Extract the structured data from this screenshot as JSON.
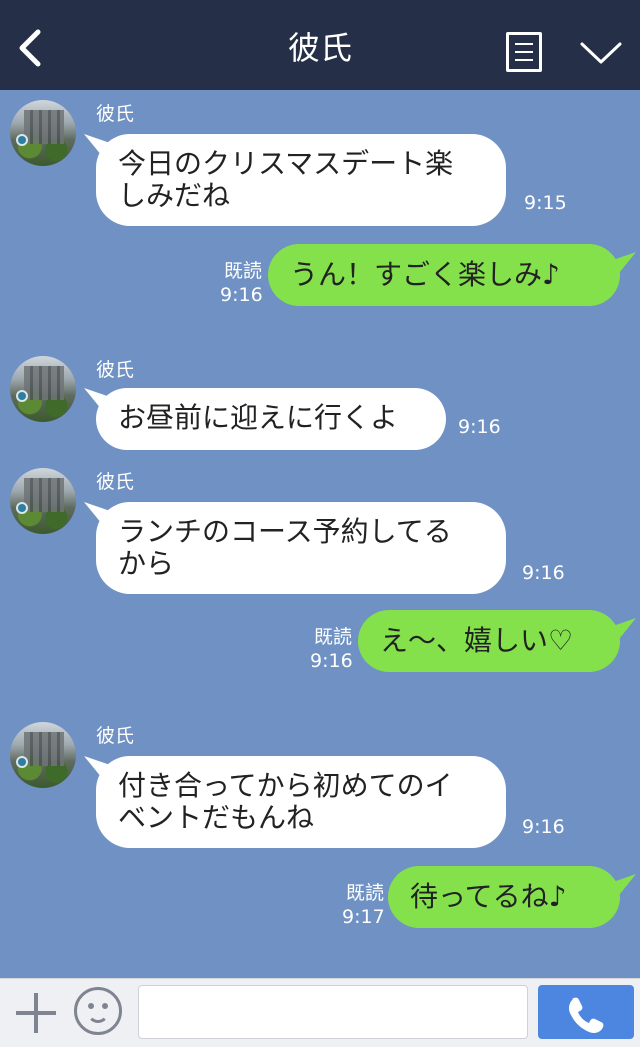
{
  "header": {
    "title": "彼氏"
  },
  "icons": {
    "back": "chevron-left-icon",
    "menu": "list-menu-icon",
    "collapse": "chevron-down-icon",
    "add": "plus-icon",
    "emoji": "smiley-icon",
    "call": "phone-icon"
  },
  "colors": {
    "header_bg": "#253048",
    "chat_bg": "#6f91c4",
    "incoming_bubble": "#ffffff",
    "outgoing_bubble": "#84e14c",
    "call_button": "#4d86e0"
  },
  "messages": [
    {
      "direction": "in",
      "sender": "彼氏",
      "lines": [
        "今日のクリスマスデート楽",
        "しみだね"
      ],
      "time": "9:15"
    },
    {
      "direction": "out",
      "read": "既読",
      "lines": [
        "うん！すごく楽しみ♪"
      ],
      "time": "9:16"
    },
    {
      "direction": "in",
      "sender": "彼氏",
      "lines": [
        "お昼前に迎えに行くよ"
      ],
      "time": "9:16"
    },
    {
      "direction": "in",
      "sender": "彼氏",
      "lines": [
        "ランチのコース予約してる",
        "から"
      ],
      "time": "9:16"
    },
    {
      "direction": "out",
      "read": "既読",
      "lines": [
        "え〜、嬉しい♡"
      ],
      "time": "9:16"
    },
    {
      "direction": "in",
      "sender": "彼氏",
      "lines": [
        "付き合ってから初めてのイ",
        "ベントだもんね"
      ],
      "time": "9:16"
    },
    {
      "direction": "out",
      "read": "既読",
      "lines": [
        "待ってるね♪"
      ],
      "time": "9:17"
    }
  ],
  "composer": {
    "value": "",
    "placeholder": ""
  }
}
